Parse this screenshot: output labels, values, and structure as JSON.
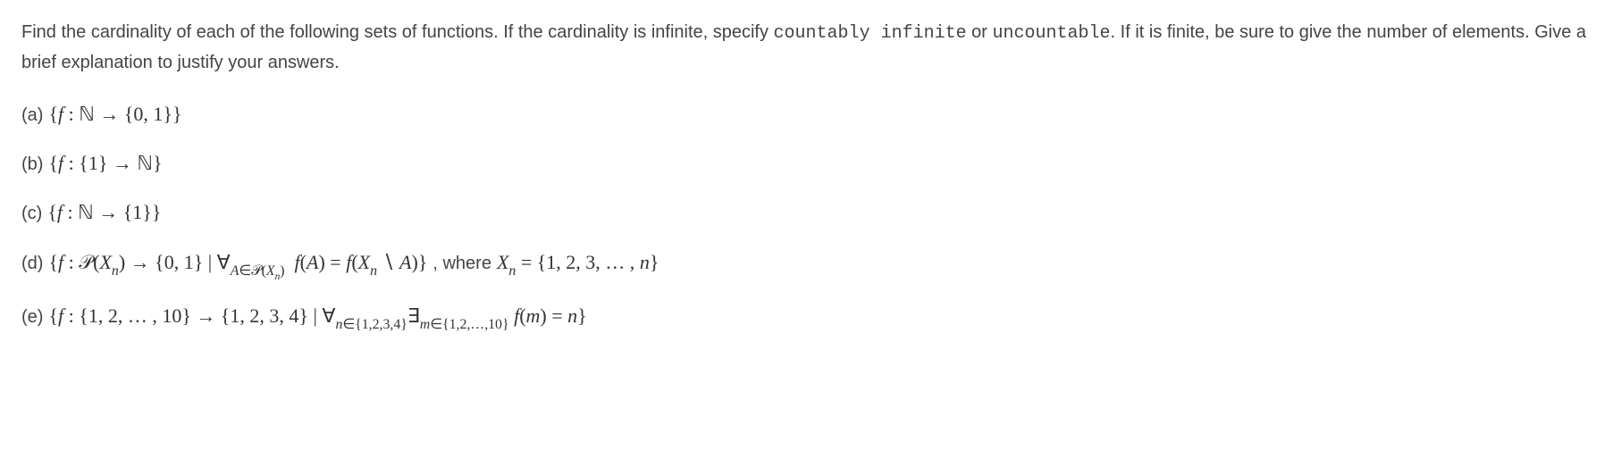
{
  "intro": {
    "part1": "Find the cardinality of each of the following sets of functions. If the cardinality is infinite, specify ",
    "code1": "countably infinite",
    "part2": " or ",
    "code2": "uncountable",
    "part3": ". If it is finite, be sure to give the number of elements. Give a brief explanation to justify your answers."
  },
  "items": [
    {
      "label": "(a)",
      "math_html": "{<span class='it'>f</span> : ℕ → {0, 1}}"
    },
    {
      "label": "(b)",
      "math_html": "{<span class='it'>f</span> : {1} → ℕ}"
    },
    {
      "label": "(c)",
      "math_html": "{<span class='it'>f</span> : ℕ → {1}}"
    },
    {
      "label": "(d)",
      "math_html": "{<span class='it'>f</span> : 𝒫(<span class='it'>X</span><span class='sub it'>n</span>) → {0, 1} | ∀<span class='sub'><span class='it'>A</span>∈𝒫(<span class='it'>X</span><span class='sub it'>n</span>)</span> &nbsp;<span class='it'>f</span>(<span class='it'>A</span>) = <span class='it'>f</span>(<span class='it'>X</span><span class='sub it'>n</span> ∖ <span class='it'>A</span>)}",
      "aside_prefix": ", where ",
      "aside_math_html": "<span class='it'>X</span><span class='sub it'>n</span> = {1, 2, 3, … , <span class='it'>n</span>}"
    },
    {
      "label": "(e)",
      "math_html": "{<span class='it'>f</span> : {1, 2, … , 10} → {1, 2, 3, 4} | ∀<span class='sub'><span class='it'>n</span>∈{1,2,3,4}</span>∃<span class='sub'><span class='it'>m</span>∈{1,2,…,10}</span> <span class='it'>f</span>(<span class='it'>m</span>) = <span class='it'>n</span>}"
    }
  ]
}
